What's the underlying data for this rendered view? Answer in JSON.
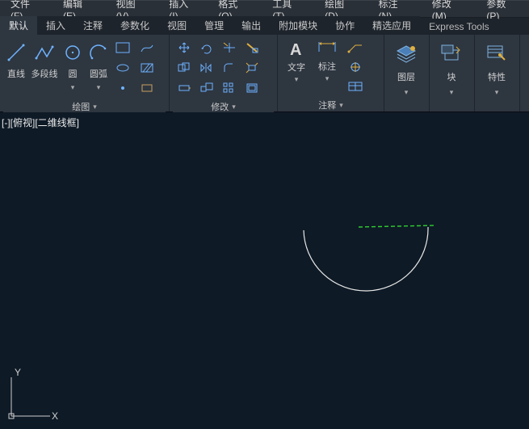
{
  "menubar": [
    "文件(F)",
    "编辑(E)",
    "视图(V)",
    "插入(I)",
    "格式(O)",
    "工具(T)",
    "绘图(D)",
    "标注(N)",
    "修改(M)",
    "参数(P)"
  ],
  "tabs": {
    "items": [
      "默认",
      "插入",
      "注释",
      "参数化",
      "视图",
      "管理",
      "输出",
      "附加模块",
      "协作",
      "精选应用",
      "Express Tools"
    ],
    "active": 0
  },
  "ribbon": {
    "draw": {
      "title": "绘图",
      "line": "直线",
      "polyline": "多段线",
      "circle": "圆",
      "arc": "圆弧"
    },
    "modify": {
      "title": "修改"
    },
    "annotation": {
      "title": "注释",
      "text": "文字",
      "dim": "标注"
    },
    "layers": {
      "title": "图层"
    },
    "blocks": {
      "title": "块"
    },
    "properties": {
      "title": "特性"
    }
  },
  "canvas": {
    "viewLabel": "[-][俯视][二维线框]",
    "axis_x": "X",
    "axis_y": "Y"
  }
}
